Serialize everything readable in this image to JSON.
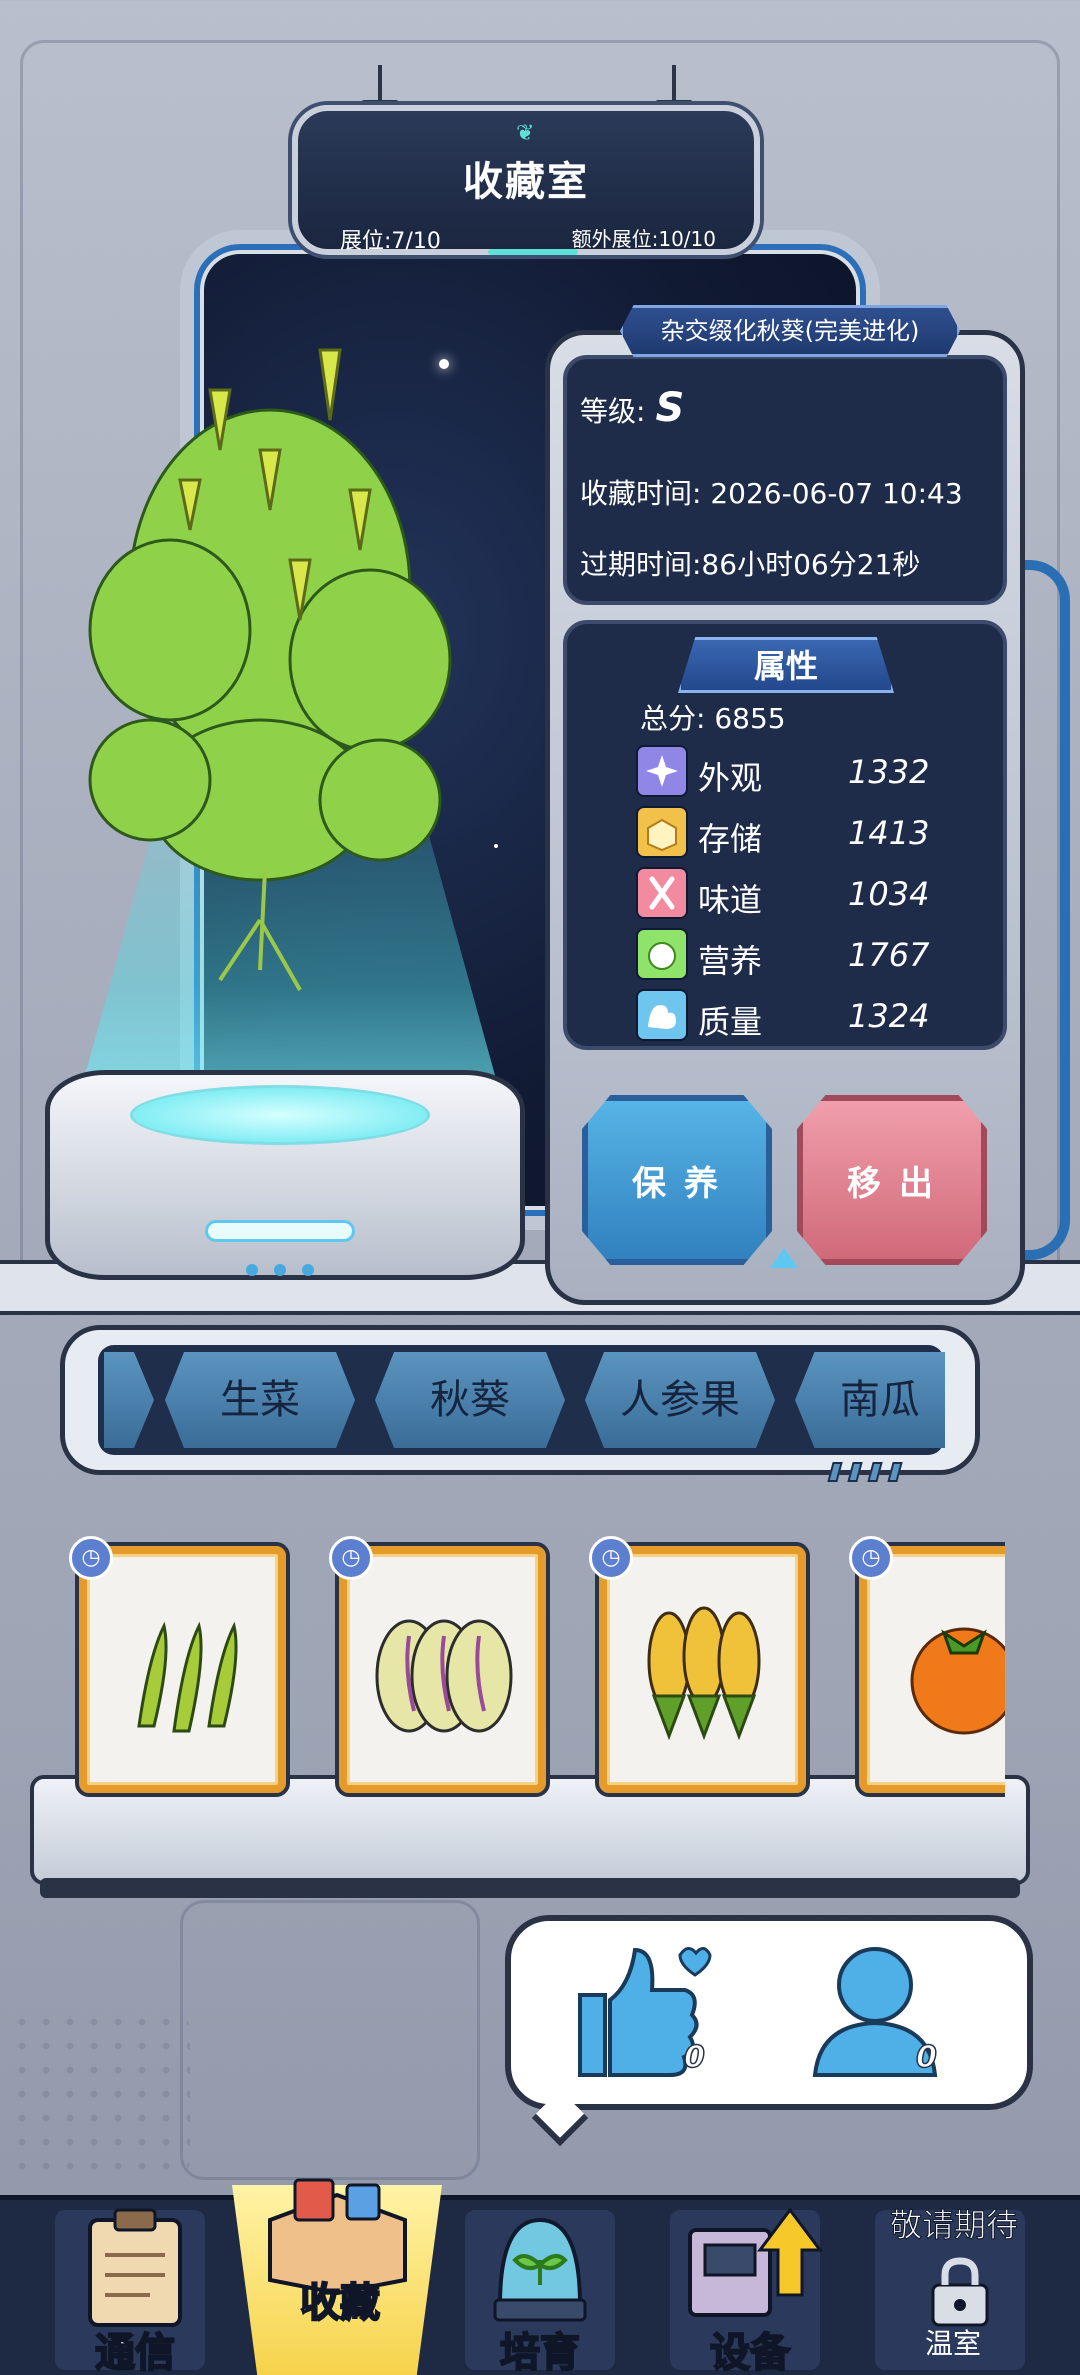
{
  "header": {
    "title": "收藏室",
    "slots": "展位:7/10",
    "extra_slots": "额外展位:10/10"
  },
  "plant": {
    "name": "杂交缀化秋葵(完美进化)",
    "grade_label": "等级:",
    "grade": "S",
    "collected_time": "收藏时间: 2026-06-07 10:43",
    "expire_time": "过期时间:86小时06分21秒"
  },
  "attributes": {
    "title": "属性",
    "total": "总分: 6855",
    "items": [
      {
        "name": "外观",
        "value": "1332",
        "color": "#8f86e6"
      },
      {
        "name": "存储",
        "value": "1413",
        "color": "#f2c14a"
      },
      {
        "name": "味道",
        "value": "1034",
        "color": "#f28aa0"
      },
      {
        "name": "营养",
        "value": "1767",
        "color": "#8fe36b"
      },
      {
        "name": "质量",
        "value": "1324",
        "color": "#6ec6ef"
      }
    ]
  },
  "actions": {
    "care": "保养",
    "remove": "移出"
  },
  "tabs": [
    "生菜",
    "秋葵",
    "人参果",
    "南瓜"
  ],
  "social": {
    "likes": "0",
    "visitors": "0"
  },
  "nav": {
    "comm": "通信",
    "collect": "收藏",
    "breed": "培育",
    "device": "设备",
    "greenhouse": "温室",
    "coming_soon": "敬请期待"
  },
  "colors": {
    "accent_blue": "#3a7fc0",
    "panel_dark": "#1e2c4a",
    "remove_red": "#cf6878"
  }
}
